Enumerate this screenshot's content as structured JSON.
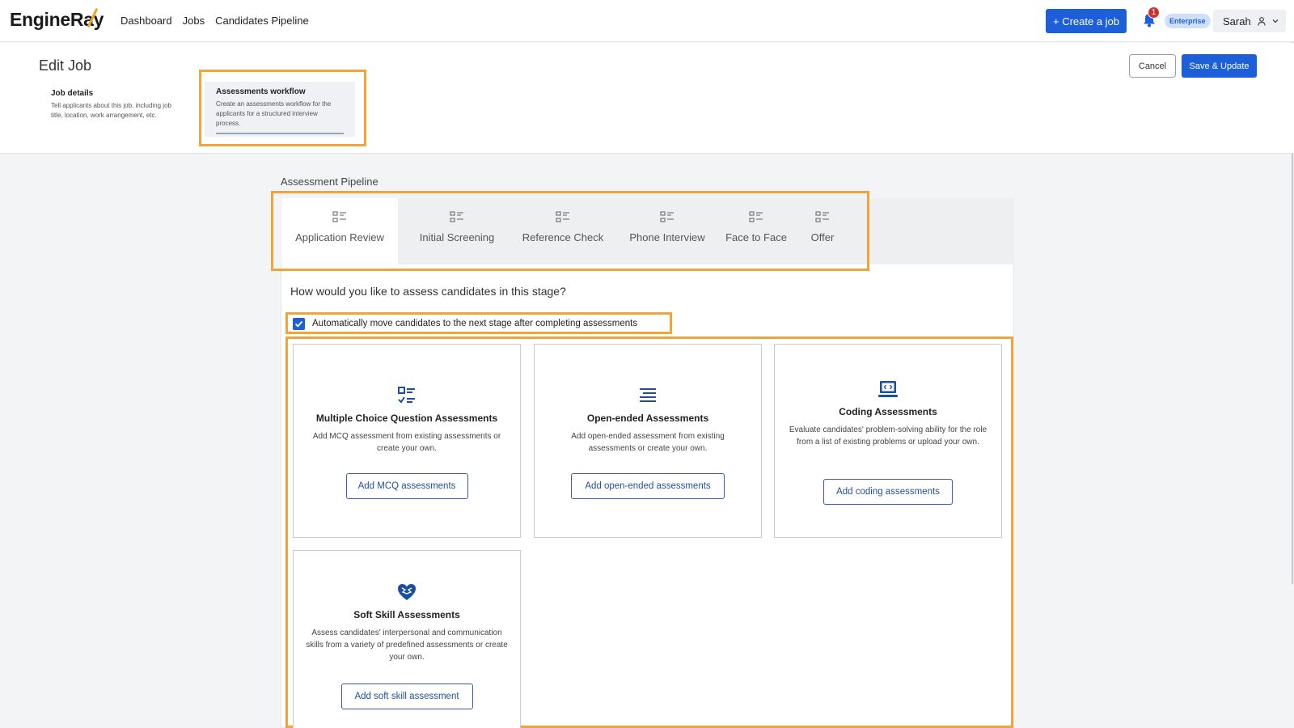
{
  "header": {
    "logo": "EngineRay",
    "nav": [
      "Dashboard",
      "Jobs",
      "Candidates Pipeline"
    ],
    "create_button": "+ Create a job",
    "notification_count": "1",
    "plan_badge": "Enterprise",
    "user_name": "Sarah"
  },
  "edit": {
    "title": "Edit Job",
    "cancel": "Cancel",
    "save": "Save & Update",
    "steps": [
      {
        "title": "Job details",
        "desc": "Tell applicants about this job, including job title, location, work arrangement, etc."
      },
      {
        "title": "Assessments workflow",
        "desc": "Create an assessments workflow for the applicants for a structured interview process."
      }
    ]
  },
  "pipeline": {
    "label": "Assessment Pipeline",
    "tabs": [
      "Application Review",
      "Initial Screening",
      "Reference Check",
      "Phone Interview",
      "Face to Face",
      "Offer"
    ],
    "active_tab": "Application Review",
    "question": "How would you like to assess candidates in this stage?",
    "auto_move_label": "Automatically move candidates to the next stage after completing assessments",
    "auto_move_checked": true
  },
  "cards": [
    {
      "title": "Multiple Choice Question Assessments",
      "desc": "Add MCQ assessment from existing assessments or create your own.",
      "button": "Add MCQ assessments",
      "icon": "checklist-icon"
    },
    {
      "title": "Open-ended Assessments",
      "desc": "Add open-ended assessment from existing assessments or create your own.",
      "button": "Add open-ended assessments",
      "icon": "text-lines-icon"
    },
    {
      "title": "Coding Assessments",
      "desc": "Evaluate candidates' problem-solving ability for the role from a list of existing problems or upload your own.",
      "button": "Add coding assessments",
      "icon": "laptop-code-icon"
    },
    {
      "title": "Soft Skill Assessments",
      "desc": "Assess candidates' interpersonal and communication skills from a variety of predefined assessments or create your own.",
      "button": "Add soft skill assessment",
      "icon": "heart-brain-icon"
    }
  ],
  "colors": {
    "primary": "#1d5fd8",
    "highlight": "#f0a43a",
    "logo_accent": "#f5a623"
  }
}
